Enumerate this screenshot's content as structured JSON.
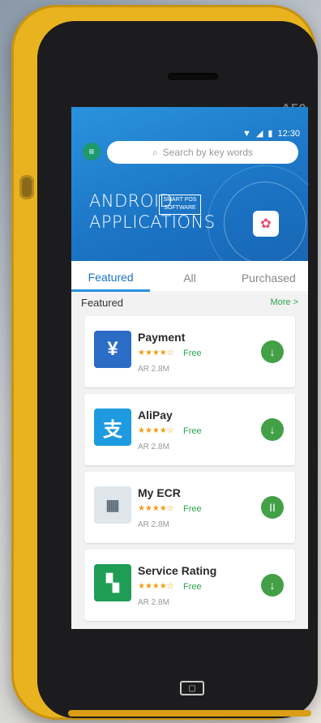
{
  "device": {
    "model": "A50"
  },
  "status": {
    "time": "12:30"
  },
  "search": {
    "placeholder": "Search by key words"
  },
  "banner": {
    "line1": "ANDROID",
    "line2": "APPLICATIONS",
    "badge_line1": "SMART POS",
    "badge_line2": "SOFTWARE"
  },
  "tabs": [
    {
      "label": "Featured"
    },
    {
      "label": "All"
    },
    {
      "label": "Purchased"
    }
  ],
  "section": {
    "title": "Featured",
    "more": "More >"
  },
  "apps": [
    {
      "name": "Payment",
      "rating": 4,
      "price": "Free",
      "size": "AR 2.8M",
      "icon": "payment-icon",
      "icon_color": "#2b6cc4",
      "action": "download"
    },
    {
      "name": "AliPay",
      "rating": 4,
      "price": "Free",
      "size": "AR 2.8M",
      "icon": "alipay-icon",
      "icon_color": "#1e9be0",
      "action": "download"
    },
    {
      "name": "My ECR",
      "rating": 4,
      "price": "Free",
      "size": "AR 2.8M",
      "icon": "ecr-icon",
      "icon_color": "#dfe6ec",
      "action": "pause"
    },
    {
      "name": "Service Rating",
      "rating": 4,
      "price": "Free",
      "size": "AR 2.8M",
      "icon": "service-rating-icon",
      "icon_color": "#1f9d55",
      "action": "download"
    }
  ],
  "colors": {
    "accent": "#2a93dd",
    "green": "#43a047",
    "device": "#e9b320"
  }
}
